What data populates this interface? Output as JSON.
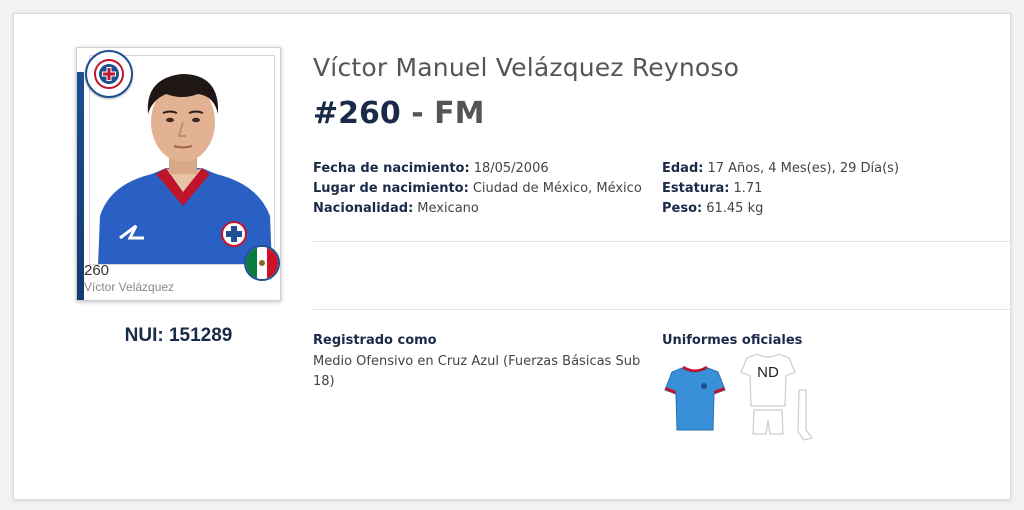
{
  "player": {
    "full_name": "Víctor Manuel Velázquez Reynoso",
    "number": "#260",
    "separator": "-",
    "position": "FM",
    "nui_label": "NUI:",
    "nui_value": "151289"
  },
  "sticker": {
    "number": "260",
    "name": "Víctor Velázquez"
  },
  "details_left": [
    {
      "label": "Fecha de nacimiento:",
      "value": "18/05/2006"
    },
    {
      "label": "Lugar de nacimiento:",
      "value": "Ciudad de México, México"
    },
    {
      "label": "Nacionalidad:",
      "value": "Mexicano"
    }
  ],
  "details_right": [
    {
      "label": "Edad:",
      "value": "17 Años, 4 Mes(es), 29 Día(s)"
    },
    {
      "label": "Estatura:",
      "value": "1.71"
    },
    {
      "label": "Peso:",
      "value": "61.45 kg"
    }
  ],
  "registration": {
    "title": "Registrado como",
    "text": "Medio Ofensivo en Cruz Azul (Fuerzas Básicas Sub 18)"
  },
  "uniforms": {
    "title": "Uniformes oficiales",
    "alt_label": "ND"
  },
  "colors": {
    "navy": "#1a2b49",
    "club_blue": "#1d4f91",
    "home_shirt": "#3a8fd9"
  }
}
